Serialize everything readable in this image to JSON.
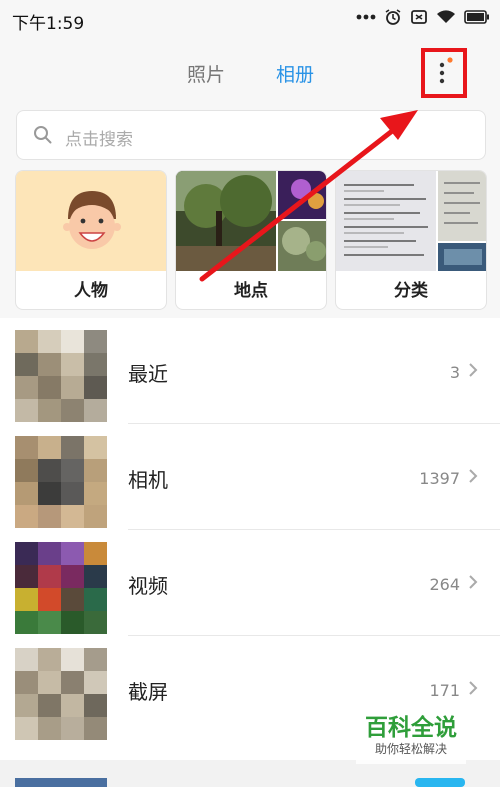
{
  "status": {
    "time": "下午1:59"
  },
  "tabs": [
    {
      "label": "照片",
      "active": false
    },
    {
      "label": "相册",
      "active": true
    }
  ],
  "search": {
    "placeholder": "点击搜索"
  },
  "categories": [
    {
      "label": "人物"
    },
    {
      "label": "地点"
    },
    {
      "label": "分类"
    }
  ],
  "albums": [
    {
      "name": "最近",
      "count": "3"
    },
    {
      "name": "相机",
      "count": "1397"
    },
    {
      "name": "视频",
      "count": "264"
    },
    {
      "name": "截屏",
      "count": "171"
    }
  ],
  "watermark": {
    "title": "百科全说",
    "subtitle": "助你轻松解决"
  },
  "colors": {
    "accent": "#2a93e6",
    "highlight": "#e8161b",
    "badge": "#ff7a2e",
    "watermark": "#2f9e3a"
  }
}
